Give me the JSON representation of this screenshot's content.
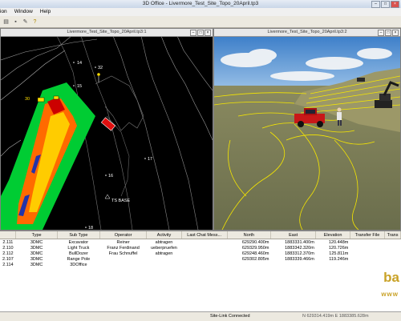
{
  "window": {
    "title": "3D Office - Livermore_Test_Site_Topo_20April.tp3"
  },
  "menu": [
    "ion",
    "Window",
    "Help"
  ],
  "toolbar": {
    "icons": [
      "open-icon",
      "save-icon",
      "tool-icon",
      "help-icon"
    ]
  },
  "left_pane": {
    "title": "Livermore_Test_Site_Topo_20April.tp3:1",
    "labels": [
      {
        "text": "14"
      },
      {
        "text": "32"
      },
      {
        "text": "15"
      },
      {
        "text": "16"
      },
      {
        "text": "17"
      },
      {
        "text": "18"
      },
      {
        "text": "TS BASE"
      },
      {
        "text": "30"
      }
    ]
  },
  "right_pane": {
    "title": "Livermore_Test_Site_Topo_20April.tp3:2"
  },
  "grid": {
    "columns": [
      "",
      "Type",
      "Sub Type",
      "Operator",
      "Activity",
      "Last Chat Mess...",
      "North",
      "East",
      "Elevation",
      "Transfer File",
      "Trans"
    ],
    "rows": [
      [
        "2.111",
        "3DMC",
        "Excavator",
        "Reiner",
        "abtragen",
        "",
        "629290.400m",
        "1883331.400m",
        "120.448m",
        "",
        ""
      ],
      [
        "2.110",
        "3DMC",
        "Light Truck",
        "Franz Ferdinand",
        "ueberpruefen",
        "",
        "629329.950m",
        "1883342.320m",
        "120.726m",
        "",
        ""
      ],
      [
        "2.112",
        "3DMC",
        "BullDozer",
        "Frau Schnuffel",
        "abtragen",
        "",
        "629248.460m",
        "1883312.370m",
        "125.811m",
        "",
        ""
      ],
      [
        "2.107",
        "3DMC",
        "Range Pole",
        "",
        "",
        "",
        "629302.805m",
        "1883339.466m",
        "119.246m",
        "",
        ""
      ],
      [
        "2.114",
        "3DMC",
        "3DOffice",
        "",
        "",
        "",
        "",
        "",
        "",
        "",
        ""
      ]
    ]
  },
  "logo": {
    "line1": "ba",
    "line2": "www"
  },
  "status": {
    "connection": "Site-Link Connected",
    "coords": "N 629314.419m    E 1883385.628m"
  }
}
